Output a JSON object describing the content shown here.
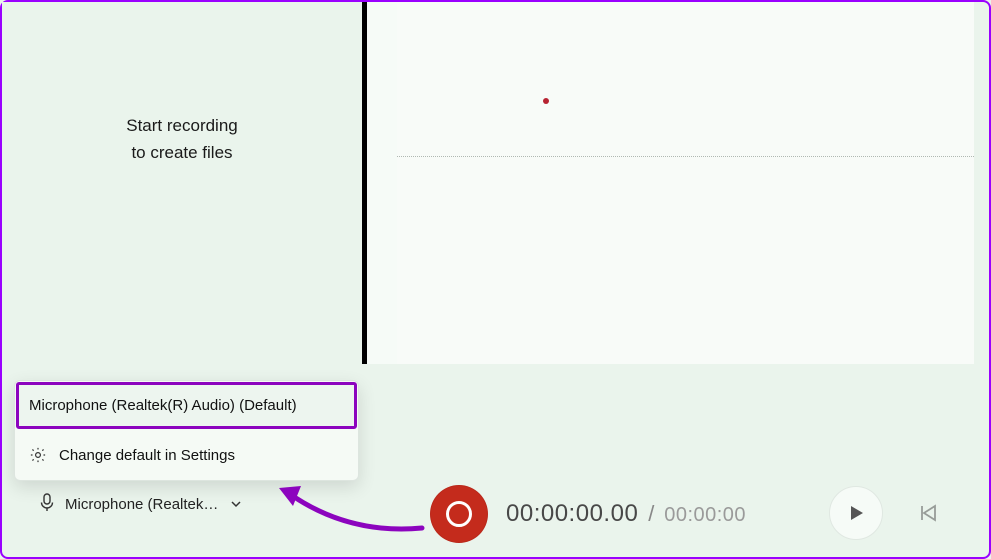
{
  "empty_state": {
    "line1": "Start recording",
    "line2": "to create files"
  },
  "device_popup": {
    "selected_label": "Microphone (Realtek(R) Audio) (Default)",
    "settings_label": "Change default in Settings"
  },
  "mic_selector": {
    "label": "Microphone (Realtek(..."
  },
  "playback": {
    "current_time": "00:00:00.00",
    "separator": "/",
    "total_time": "00:00:00"
  },
  "icons": {
    "gear": "gear-icon",
    "mic": "microphone-icon",
    "chevron_down": "chevron-down-icon",
    "record": "record-icon",
    "play": "play-icon",
    "skip_back": "skip-back-icon"
  },
  "colors": {
    "accent_red": "#c42b1c",
    "highlight_purple": "#8c04be",
    "bg_mint": "#eaf4ec"
  }
}
